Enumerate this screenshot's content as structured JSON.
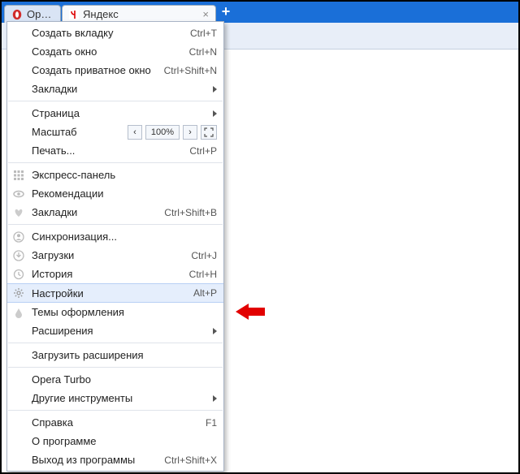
{
  "tabs": {
    "opera": "Opera",
    "site": "Яндекс"
  },
  "menu": {
    "new_tab": {
      "label": "Создать вкладку",
      "shortcut": "Ctrl+T"
    },
    "new_window": {
      "label": "Создать окно",
      "shortcut": "Ctrl+N"
    },
    "new_private": {
      "label": "Создать приватное окно",
      "shortcut": "Ctrl+Shift+N"
    },
    "bookmarks_sub": {
      "label": "Закладки"
    },
    "page_sub": {
      "label": "Страница"
    },
    "zoom": {
      "label": "Масштаб",
      "value": "100%"
    },
    "print": {
      "label": "Печать...",
      "shortcut": "Ctrl+P"
    },
    "speed_dial": {
      "label": "Экспресс-панель"
    },
    "recommendations": {
      "label": "Рекомендации"
    },
    "bookmarks": {
      "label": "Закладки",
      "shortcut": "Ctrl+Shift+B"
    },
    "sync": {
      "label": "Синхронизация..."
    },
    "downloads": {
      "label": "Загрузки",
      "shortcut": "Ctrl+J"
    },
    "history": {
      "label": "История",
      "shortcut": "Ctrl+H"
    },
    "settings": {
      "label": "Настройки",
      "shortcut": "Alt+P"
    },
    "themes": {
      "label": "Темы оформления"
    },
    "extensions_sub": {
      "label": "Расширения"
    },
    "get_extensions": {
      "label": "Загрузить расширения"
    },
    "turbo": {
      "label": "Opera Turbo"
    },
    "other_tools": {
      "label": "Другие инструменты"
    },
    "help": {
      "label": "Справка",
      "shortcut": "F1"
    },
    "about": {
      "label": "О программе"
    },
    "exit": {
      "label": "Выход из программы",
      "shortcut": "Ctrl+Shift+X"
    }
  }
}
